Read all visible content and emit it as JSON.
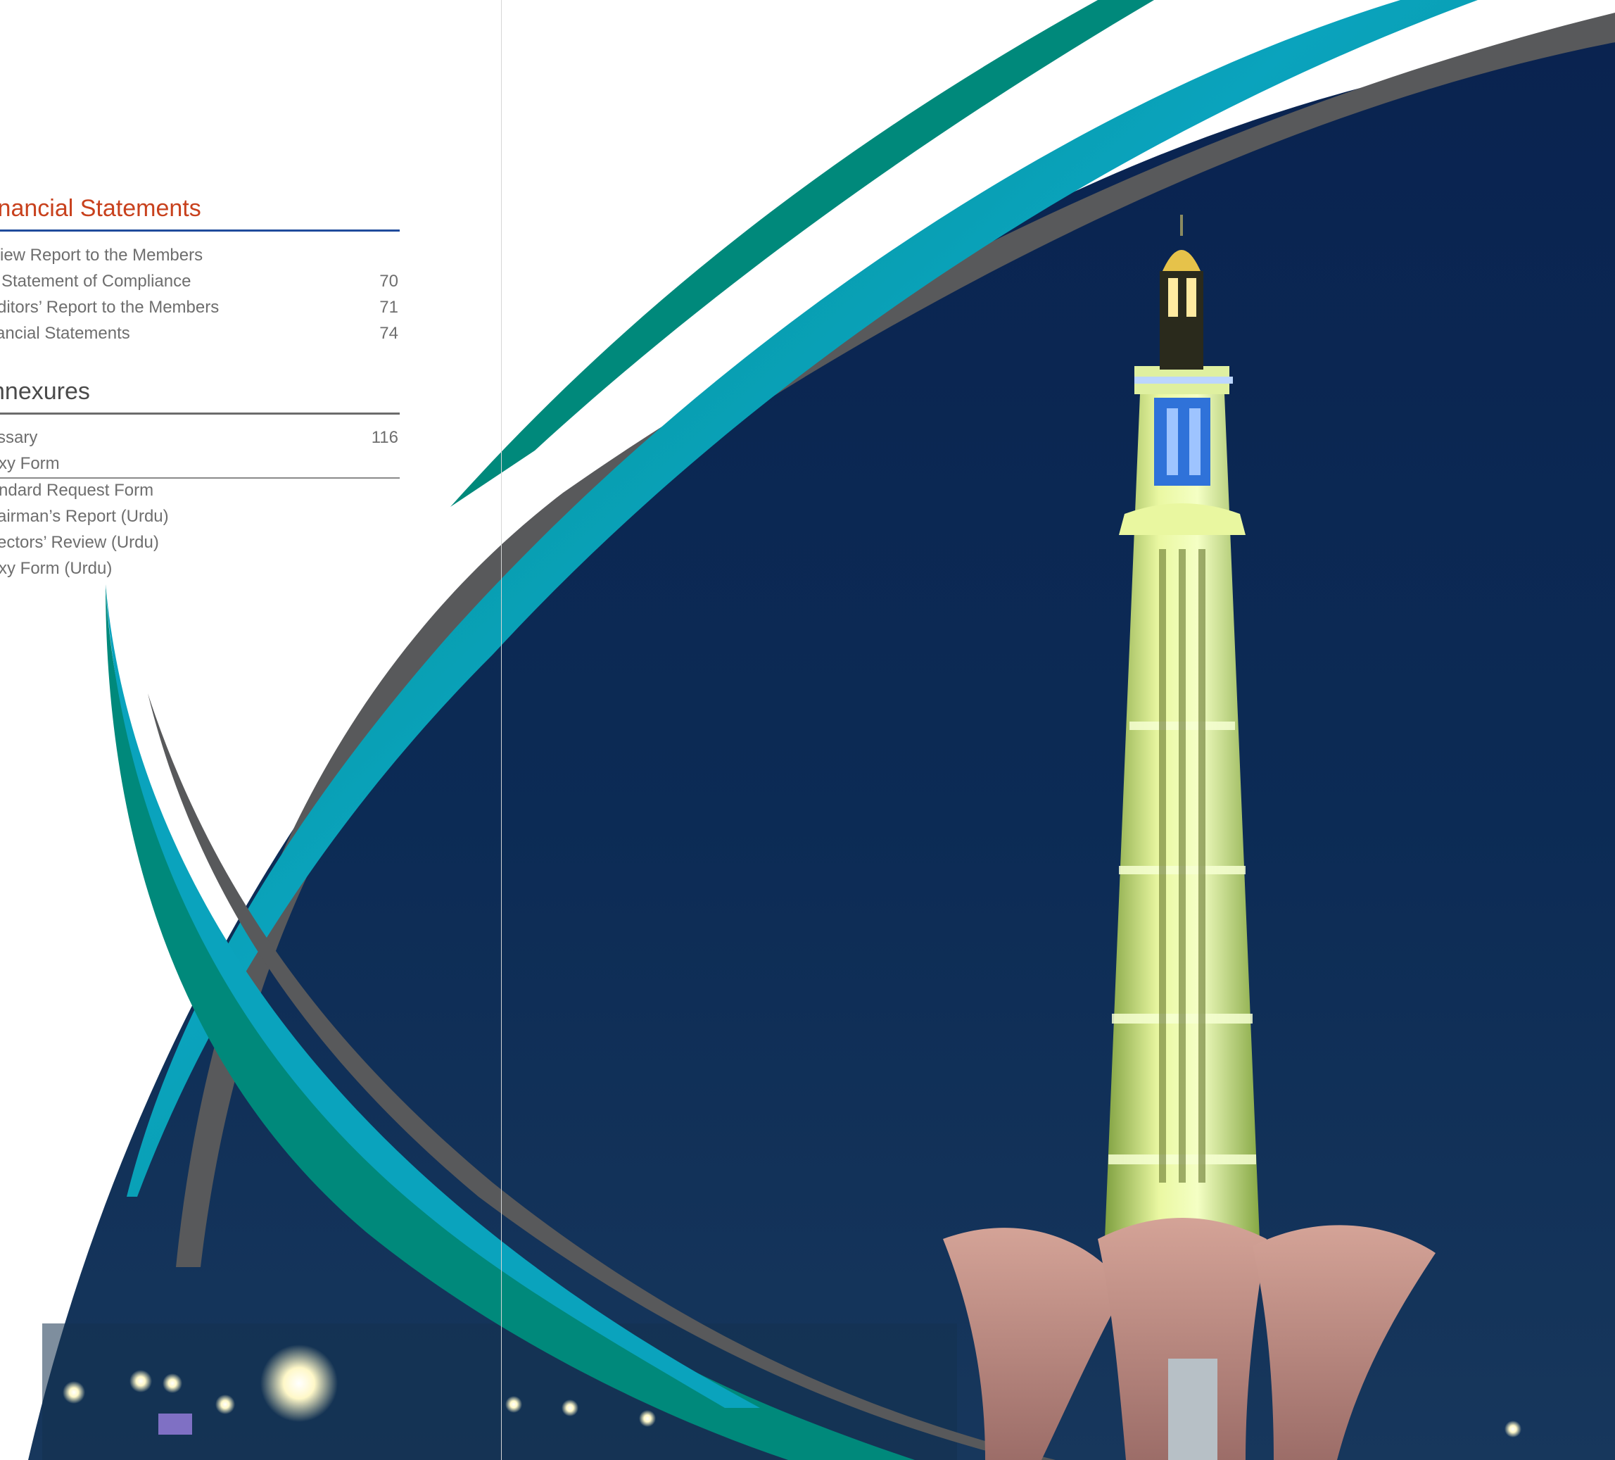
{
  "toc": {
    "financial": {
      "title": "inancial Statements",
      "items": [
        {
          "label": "view Report to the Members",
          "page": ""
        },
        {
          "label": "Statement of Compliance",
          "page": "70"
        },
        {
          "label": "ditors’ Report to the Members",
          "page": "71"
        },
        {
          "label": "ancial Statements",
          "page": "74"
        }
      ]
    },
    "annexures": {
      "title": "nnexures",
      "items": [
        {
          "label": "ssary",
          "page": "116"
        },
        {
          "label": "xy Form",
          "page": ""
        },
        {
          "label": "ndard Request Form",
          "page": ""
        },
        {
          "label": "airman’s Report (Urdu)",
          "page": ""
        },
        {
          "label": "ectors’ Review (Urdu)",
          "page": ""
        },
        {
          "label": "xy Form (Urdu)",
          "page": ""
        }
      ]
    }
  },
  "colors": {
    "financial_title": "#c8411d",
    "financial_rule": "#1f4b9c",
    "body_text": "#6e6e6e",
    "teal_swoosh": "#00897b",
    "cyan_swoosh": "#0aa3bd",
    "grey_swoosh": "#58595b",
    "night_sky": "#0c2a52",
    "tower_glow": "#e9f7a0",
    "tower_top_blue": "#2f72d9",
    "base_petals": "#c08b80"
  },
  "image": {
    "subject": "Minar-e-Pakistan illuminated at night",
    "icon": "photo-tower-icon"
  }
}
